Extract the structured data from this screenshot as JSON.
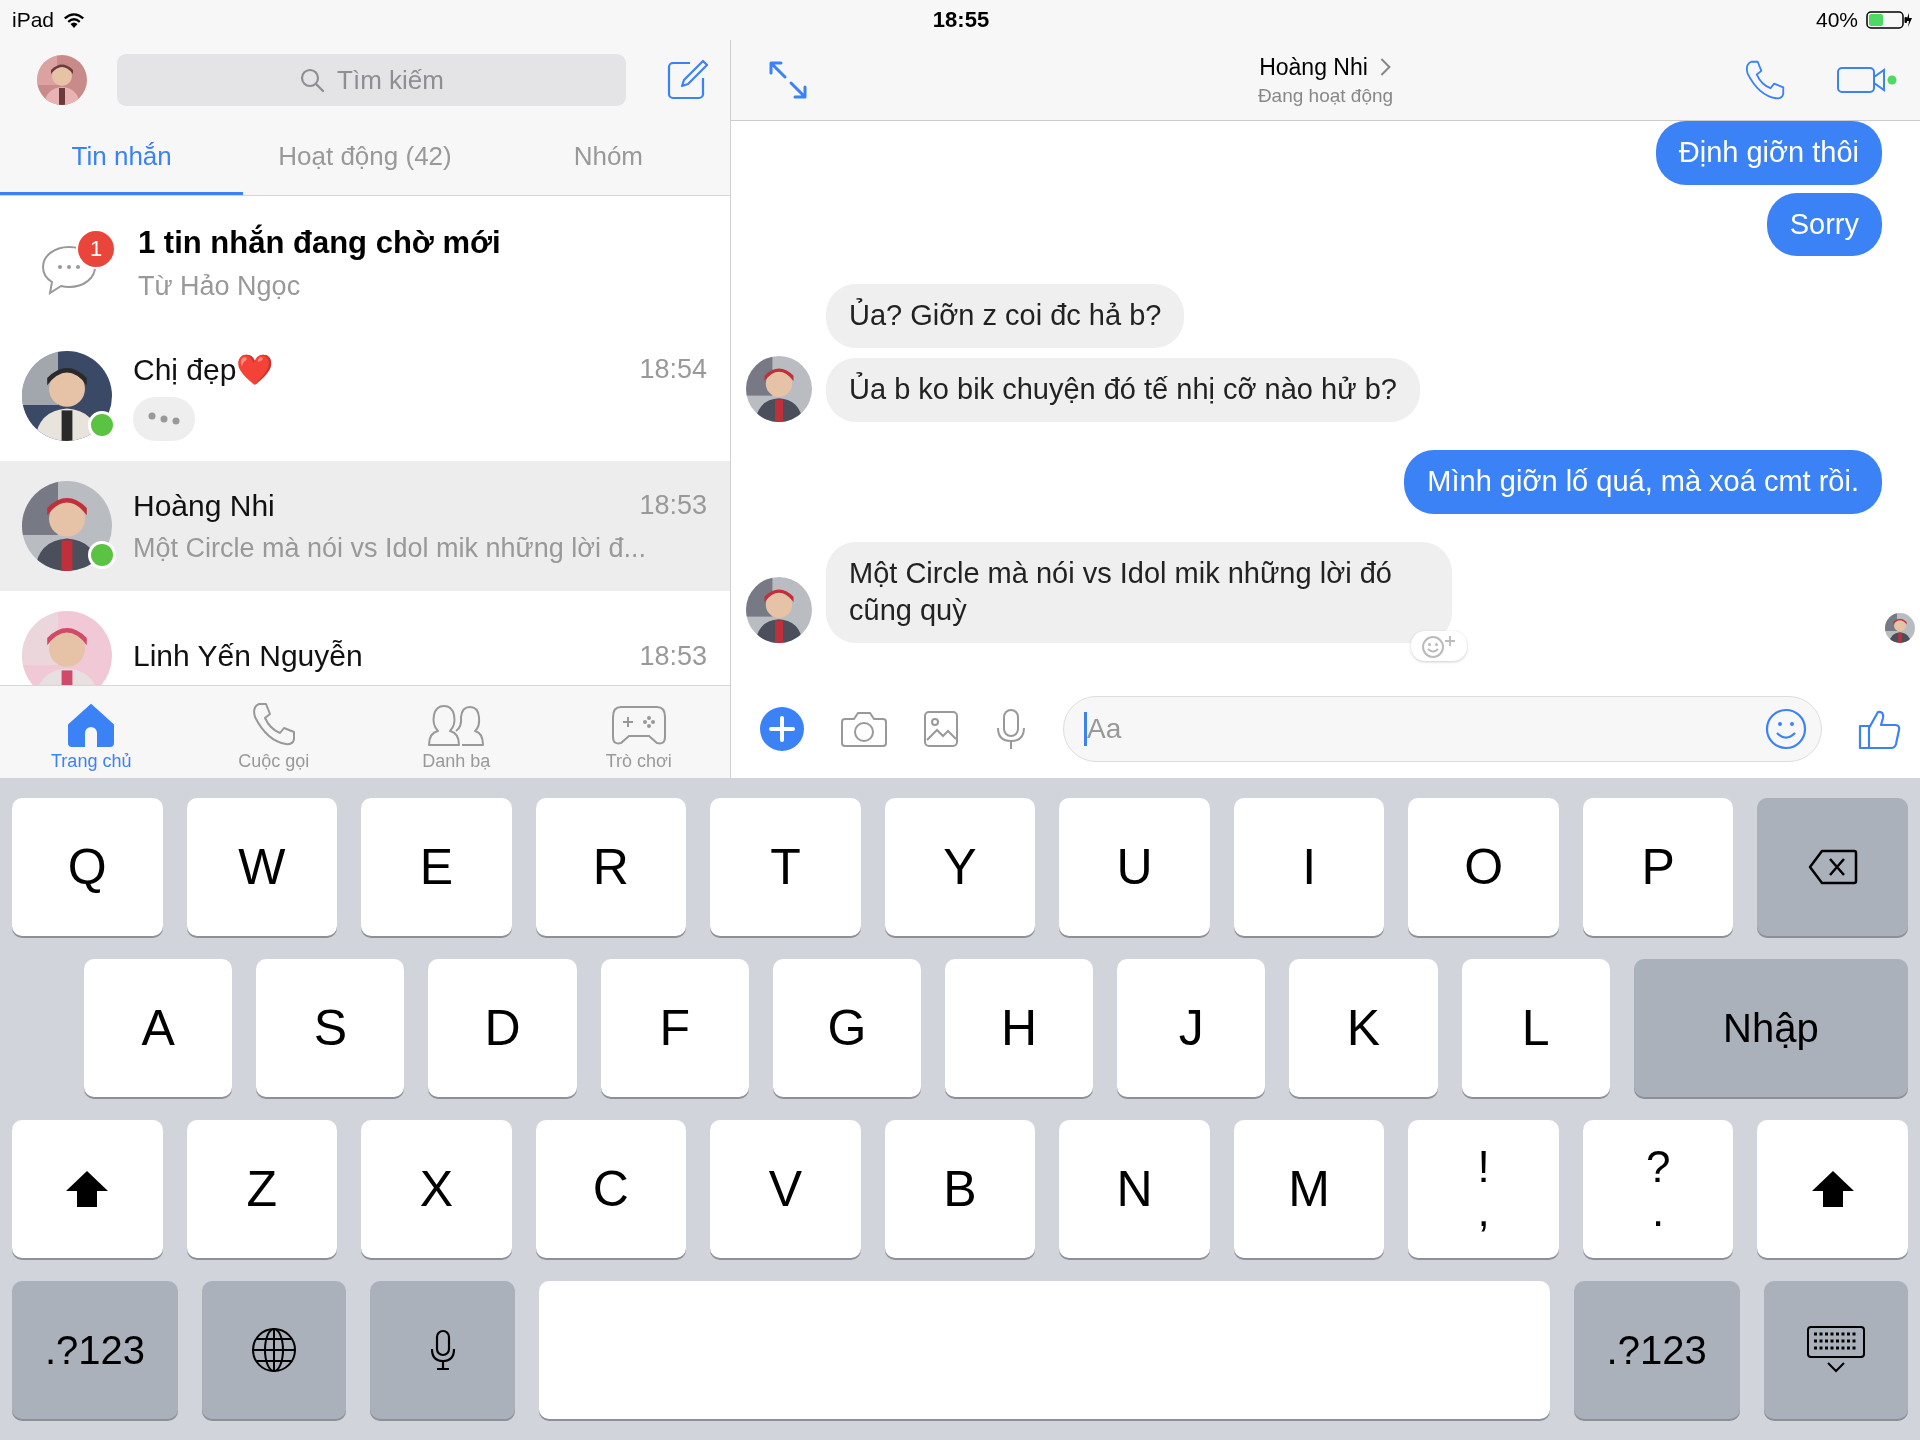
{
  "status_bar": {
    "device": "iPad",
    "time": "18:55",
    "battery": "40%"
  },
  "sidebar": {
    "search": {
      "placeholder": "Tìm kiếm"
    },
    "tabs": [
      {
        "label": "Tin nhắn",
        "selected": true
      },
      {
        "label": "Hoạt động (42)",
        "selected": false
      },
      {
        "label": "Nhóm",
        "selected": false
      }
    ],
    "pending": {
      "badge": "1",
      "title": "1 tin nhắn đang chờ mới",
      "subtitle": "Từ Hảo Ngọc"
    },
    "conversations": [
      {
        "name": "Chị đẹp❤️",
        "time": "18:54",
        "online": true,
        "typing": true,
        "selected": false
      },
      {
        "name": "Hoàng Nhi",
        "time": "18:53",
        "preview": "Một Circle mà nói vs Idol mik những lời đ...",
        "online": true,
        "typing": false,
        "selected": true
      },
      {
        "name": "Linh Yến Nguyễn",
        "time": "18:53",
        "online": false,
        "typing": false,
        "selected": false
      }
    ],
    "bottom_tabs": [
      {
        "kind": "home",
        "label": "Trang chủ",
        "selected": true
      },
      {
        "kind": "calls",
        "label": "Cuộc gọi",
        "selected": false
      },
      {
        "kind": "contacts",
        "label": "Danh bạ",
        "selected": false
      },
      {
        "kind": "games",
        "label": "Trò chơi",
        "selected": false
      }
    ]
  },
  "chat": {
    "title": "Hoàng Nhi",
    "status": "Đang hoạt động",
    "messages": [
      {
        "kind": "sent",
        "text": "Định giỡn thôi"
      },
      {
        "kind": "sent",
        "text": "Sorry"
      },
      {
        "kind": "received",
        "text": "Ủa? Giỡn z coi đc hả b?",
        "avatar": false
      },
      {
        "kind": "received",
        "text": "Ủa b ko bik chuyện đó tế nhị cỡ nào hử b?",
        "avatar": true
      },
      {
        "kind": "sent",
        "text": "Mình giỡn lố quá, mà xoá cmt rồi."
      },
      {
        "kind": "received",
        "text": "Một Circle mà nói vs Idol mik những lời đó cũng quỳ",
        "avatar": true
      }
    ],
    "composer": {
      "placeholder": "Aa"
    }
  },
  "keyboard": {
    "rows": [
      {
        "keys": [
          {
            "kind": "letter",
            "label": "Q"
          },
          {
            "kind": "letter",
            "label": "W"
          },
          {
            "kind": "letter",
            "label": "E"
          },
          {
            "kind": "letter",
            "label": "R"
          },
          {
            "kind": "letter",
            "label": "T"
          },
          {
            "kind": "letter",
            "label": "Y"
          },
          {
            "kind": "letter",
            "label": "U"
          },
          {
            "kind": "letter",
            "label": "I"
          },
          {
            "kind": "letter",
            "label": "O"
          },
          {
            "kind": "letter",
            "label": "P"
          },
          {
            "kind": "backspace"
          }
        ]
      },
      {
        "keys": [
          {
            "kind": "letter",
            "label": "A"
          },
          {
            "kind": "letter",
            "label": "S"
          },
          {
            "kind": "letter",
            "label": "D"
          },
          {
            "kind": "letter",
            "label": "F"
          },
          {
            "kind": "letter",
            "label": "G"
          },
          {
            "kind": "letter",
            "label": "H"
          },
          {
            "kind": "letter",
            "label": "J"
          },
          {
            "kind": "letter",
            "label": "K"
          },
          {
            "kind": "letter",
            "label": "L"
          },
          {
            "kind": "return",
            "label": "Nhập"
          }
        ]
      },
      {
        "keys": [
          {
            "kind": "shift"
          },
          {
            "kind": "letter",
            "label": "Z"
          },
          {
            "kind": "letter",
            "label": "X"
          },
          {
            "kind": "letter",
            "label": "C"
          },
          {
            "kind": "letter",
            "label": "V"
          },
          {
            "kind": "letter",
            "label": "B"
          },
          {
            "kind": "letter",
            "label": "N"
          },
          {
            "kind": "letter",
            "label": "M"
          },
          {
            "kind": "punct",
            "label": "!",
            "sub": ","
          },
          {
            "kind": "punct",
            "label": "?",
            "sub": "."
          },
          {
            "kind": "shift"
          }
        ]
      },
      {
        "keys": [
          {
            "kind": "mode",
            "label": ".?123"
          },
          {
            "kind": "globe"
          },
          {
            "kind": "dictation"
          },
          {
            "kind": "space"
          },
          {
            "kind": "mode",
            "label": ".?123"
          },
          {
            "kind": "dismiss"
          }
        ]
      }
    ]
  }
}
